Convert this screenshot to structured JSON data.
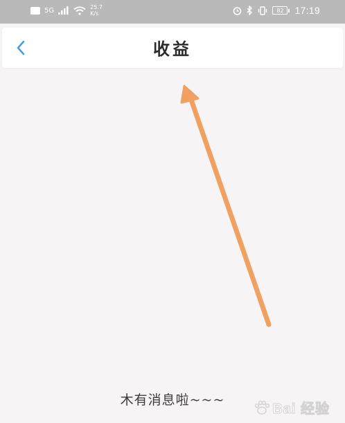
{
  "status_bar": {
    "network_label": "5G",
    "speed_label": "25.7 K/s",
    "battery_level": "82",
    "time": "17:19"
  },
  "header": {
    "back_icon": "chevron-left-icon",
    "title": "收益"
  },
  "main": {
    "empty_message": "木有消息啦~~~"
  },
  "watermark": {
    "text": "Bai 经验",
    "icon": "paw-icon"
  },
  "colors": {
    "accent": "#4a9fd8",
    "arrow": "#f0a060",
    "status_bar": "#b9b9b9",
    "background": "#f6f4f4"
  }
}
